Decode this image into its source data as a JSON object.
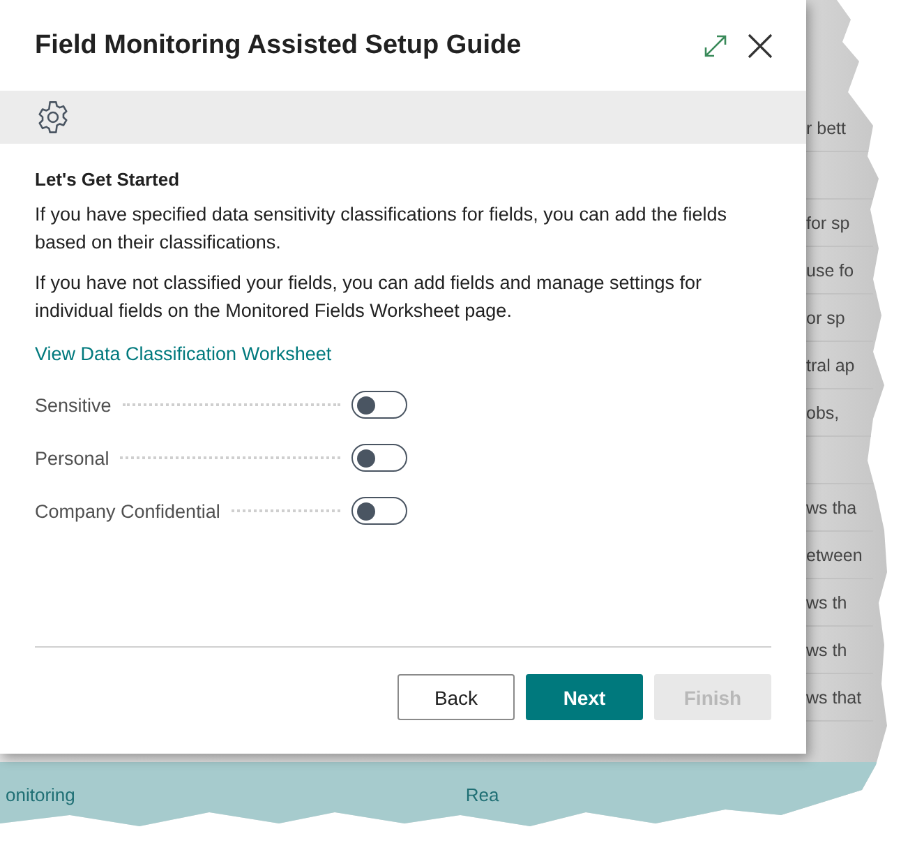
{
  "background_page": {
    "rows": [
      {
        "kind": "text",
        "text": "r bett"
      },
      {
        "kind": "blank"
      },
      {
        "kind": "text",
        "text": "for sp"
      },
      {
        "kind": "text",
        "text": "use fo"
      },
      {
        "kind": "text",
        "text": "or sp"
      },
      {
        "kind": "text",
        "text": "tral ap"
      },
      {
        "kind": "text",
        "text": "obs,"
      },
      {
        "kind": "blank"
      },
      {
        "kind": "text",
        "text": "ws tha"
      },
      {
        "kind": "text",
        "text": "etween"
      },
      {
        "kind": "text",
        "text": "ws th"
      },
      {
        "kind": "text",
        "text": "ws th"
      },
      {
        "kind": "text",
        "text": "ws that"
      }
    ],
    "bottom_bar": [
      "onitoring",
      "Rea"
    ]
  },
  "dialog": {
    "title": "Field Monitoring Assisted Setup Guide",
    "heading": "Let's Get Started",
    "paragraphs": [
      "If you have specified data sensitivity classifications for fields, you can add the fields based on their classifications.",
      "If you have not classified your fields, you can add fields and manage settings for individual fields on the Monitored Fields Worksheet page."
    ],
    "link": "View Data Classification Worksheet",
    "toggles": [
      {
        "label": "Sensitive",
        "on": false
      },
      {
        "label": "Personal",
        "on": false
      },
      {
        "label": "Company Confidential",
        "on": false
      }
    ],
    "buttons": [
      {
        "label": "Back",
        "kind": "secondary",
        "disabled": false
      },
      {
        "label": "Next",
        "kind": "primary",
        "disabled": false
      },
      {
        "label": "Finish",
        "kind": "secondary",
        "disabled": true
      }
    ]
  }
}
